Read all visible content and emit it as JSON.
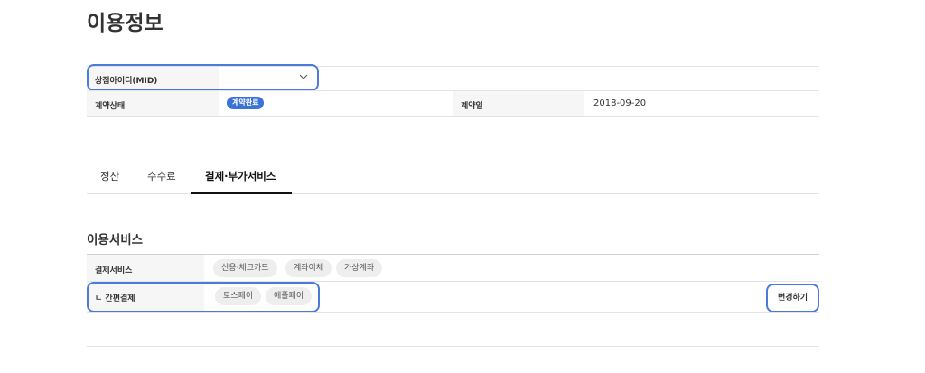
{
  "page": {
    "title": "이용정보"
  },
  "info_table": {
    "mid_label": "상점아이디(MID)",
    "mid_value": "",
    "contract_status_label": "계약상태",
    "contract_status_value": "계약완료",
    "contract_date_label": "계약일",
    "contract_date_value": "2018-09-20"
  },
  "tabs": [
    {
      "label": "정산",
      "active": false
    },
    {
      "label": "수수료",
      "active": false
    },
    {
      "label": "결제·부가서비스",
      "active": true
    }
  ],
  "services": {
    "title": "이용서비스",
    "payment_service_label": "결제서비스",
    "payment_chips": [
      "신용·체크카드",
      "계좌이체",
      "가상계좌"
    ],
    "easy_pay_label": "ㄴ 간편결제",
    "easy_pay_chips": [
      "토스페이",
      "애플페이"
    ],
    "change_button": "변경하기"
  },
  "colors": {
    "accent": "#3a72d8",
    "highlight": "#4a7bdc",
    "chip_bg": "#eeeeee",
    "label_bg": "#f6f6f6"
  }
}
